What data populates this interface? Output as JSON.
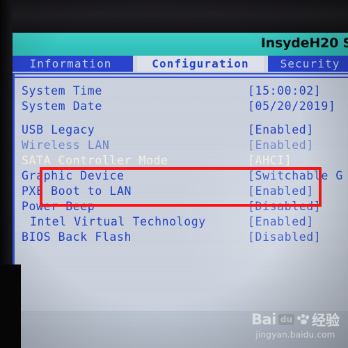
{
  "bios": {
    "vendor_title": "InsydeH20 S",
    "tabs": [
      {
        "id": "information",
        "label": "Information",
        "active": false
      },
      {
        "id": "configuration",
        "label": "Configuration",
        "active": true
      },
      {
        "id": "security",
        "label": "Security",
        "active": false
      }
    ],
    "settings": [
      {
        "label": "System Time",
        "value": "[15:00:02]"
      },
      {
        "label": "System Date",
        "value": "[05/20/2019]"
      },
      {
        "label": "USB Legacy",
        "value": "[Enabled]"
      },
      {
        "label": "Wireless LAN",
        "value": "[Enabled]"
      },
      {
        "label": "SATA Controller Mode",
        "value": "[AHCI]"
      },
      {
        "label": "Graphic Device",
        "value": "[Switchable G"
      },
      {
        "label": "PXE Boot to LAN",
        "value": "[Enabled]"
      },
      {
        "label": "Power Beep",
        "value": "[Disabled]"
      },
      {
        "label": "Intel Virtual Technology",
        "value": "[Enabled]"
      },
      {
        "label": "BIOS Back Flash",
        "value": "[Disabled]"
      }
    ],
    "selected_row": "SATA Controller Mode",
    "colors": {
      "title_band": "#31c4bd",
      "tab_active_bg": "#dfe3ec",
      "tab_inactive_bg": "#2641cf",
      "panel_bg": "#ccd3df",
      "text_blue": "#1d3fc6",
      "highlight_text": "#f7f3e2",
      "annotation_red": "#fb1417"
    }
  },
  "annotation": {
    "name": "red-highlight-box",
    "covers": [
      "Wireless LAN",
      "SATA Controller Mode",
      "Graphic Device"
    ]
  },
  "watermark": {
    "brand_bai": "Bai",
    "brand_du": "du",
    "brand_cn": "经验",
    "url": "jingyan.baidu.com"
  }
}
